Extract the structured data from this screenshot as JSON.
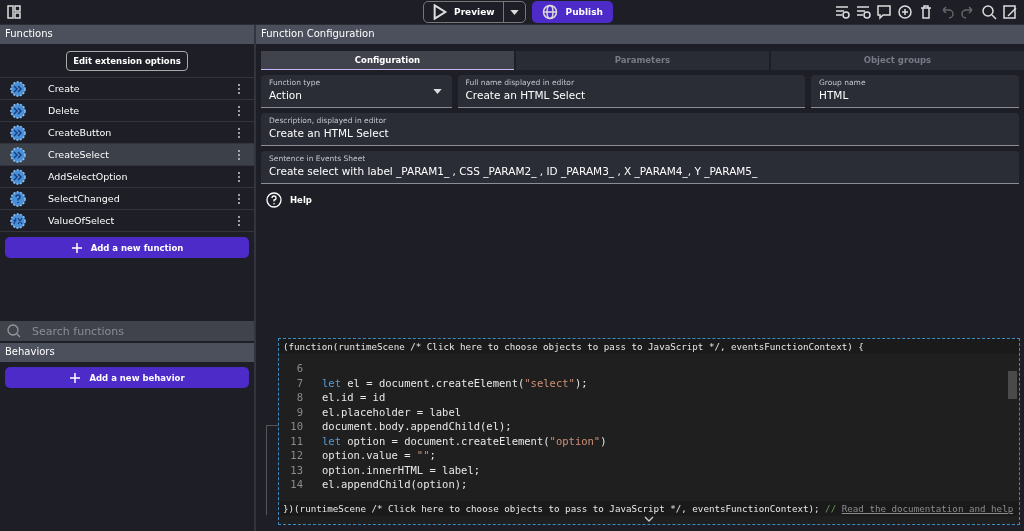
{
  "toolbar": {
    "preview": "Preview",
    "publish": "Publish"
  },
  "functions_panel": {
    "title": "Functions",
    "edit_button": "Edit extension options",
    "items": [
      {
        "name": "Create",
        "kind": "action",
        "selected": false
      },
      {
        "name": "Delete",
        "kind": "action",
        "selected": false
      },
      {
        "name": "CreateButton",
        "kind": "action",
        "selected": false
      },
      {
        "name": "CreateSelect",
        "kind": "action",
        "selected": true
      },
      {
        "name": "AddSelectOption",
        "kind": "action",
        "selected": false
      },
      {
        "name": "SelectChanged",
        "kind": "condition",
        "selected": false
      },
      {
        "name": "ValueOfSelect",
        "kind": "expression",
        "selected": false
      }
    ],
    "add_button": "Add a new function",
    "search": {
      "placeholder": "Search functions"
    }
  },
  "behaviors_panel": {
    "title": "Behaviors",
    "add_button": "Add a new behavior"
  },
  "configuration": {
    "title": "Function Configuration",
    "tabs": [
      {
        "label": "Configuration",
        "selected": true
      },
      {
        "label": "Parameters",
        "selected": false
      },
      {
        "label": "Object groups",
        "selected": false
      }
    ],
    "fields": [
      {
        "label": "Function type",
        "value": "Action",
        "kind": "select"
      },
      {
        "label": "Full name displayed in editor",
        "value": "Create an HTML Select",
        "kind": "text"
      },
      {
        "label": "Group name",
        "value": "HTML",
        "kind": "text"
      },
      {
        "label": "Description, displayed in editor",
        "value": "Create an HTML Select",
        "kind": "text"
      },
      {
        "label": "Sentence in Events Sheet",
        "value": "Create select with label _PARAM1_ , CSS _PARAM2_ , ID _PARAM3_ , X _PARAM4_, Y _PARAM5_",
        "kind": "text"
      }
    ],
    "help": "Help"
  },
  "code_editor": {
    "header": "(function(runtimeScene /* Click here to choose objects to pass to JavaScript */, eventsFunctionContext) {",
    "lines": [
      {
        "number": "6"
      },
      {
        "number": "7",
        "tokens": [
          {
            "kind": "keyword",
            "text": "let"
          },
          {
            "kind": "plain",
            "text": " el = document.createElement("
          },
          {
            "kind": "string",
            "text": "\"select\""
          },
          {
            "kind": "plain",
            "text": ");"
          }
        ]
      },
      {
        "number": "8",
        "tokens": [
          {
            "kind": "plain",
            "text": "el.id = id"
          }
        ]
      },
      {
        "number": "9",
        "tokens": [
          {
            "kind": "plain",
            "text": "el.placeholder = label"
          }
        ]
      },
      {
        "number": "10",
        "tokens": [
          {
            "kind": "plain",
            "text": "document.body.appendChild(el);"
          }
        ]
      },
      {
        "number": "11",
        "tokens": [
          {
            "kind": "keyword",
            "text": "let"
          },
          {
            "kind": "plain",
            "text": " option = document.createElement("
          },
          {
            "kind": "string",
            "text": "\"option\""
          },
          {
            "kind": "plain",
            "text": ")"
          }
        ]
      },
      {
        "number": "12",
        "tokens": [
          {
            "kind": "plain",
            "text": "option.value = "
          },
          {
            "kind": "string",
            "text": "\"\""
          },
          {
            "kind": "plain",
            "text": ";"
          }
        ]
      },
      {
        "number": "13",
        "tokens": [
          {
            "kind": "plain",
            "text": "option.innerHTML = label;"
          }
        ]
      },
      {
        "number": "14",
        "tokens": [
          {
            "kind": "plain",
            "text": "el.appendChild(option);"
          }
        ]
      }
    ],
    "footer": "})(runtimeScene /* Click here to choose objects to pass to JavaScript */, eventsFunctionContext);",
    "footer_comment": "//",
    "doc_link": "Read the documentation and help"
  }
}
